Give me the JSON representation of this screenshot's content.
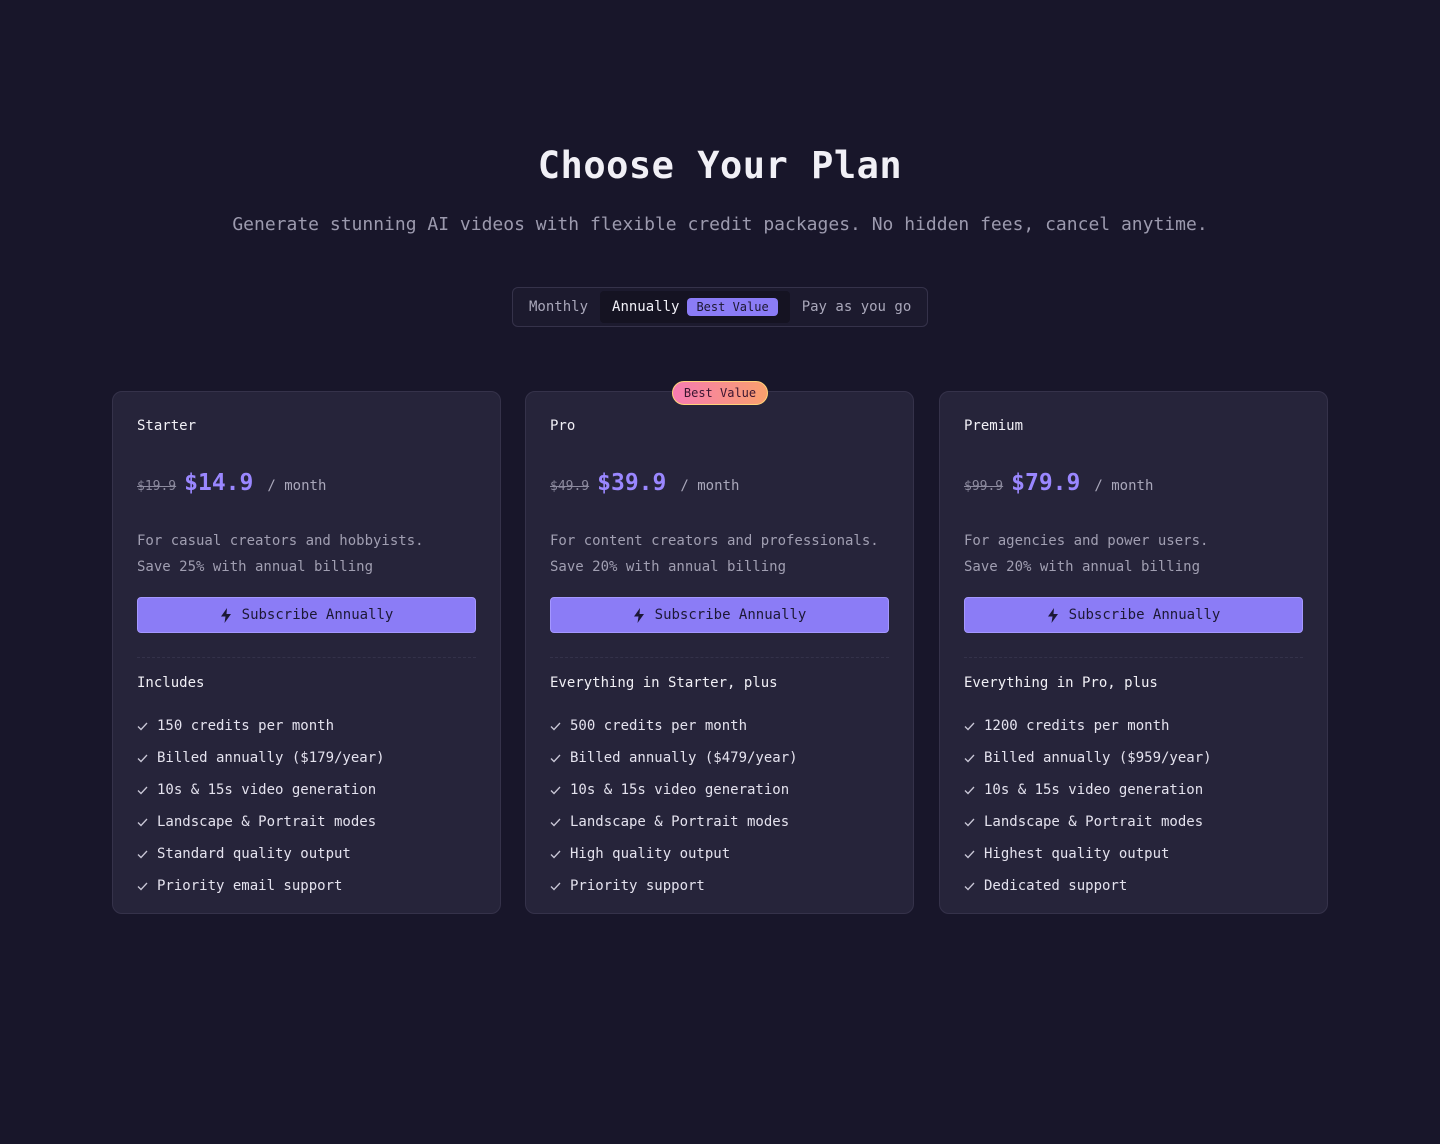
{
  "header": {
    "title": "Choose Your Plan",
    "subtitle": "Generate stunning AI videos with flexible credit packages. No hidden fees, cancel anytime."
  },
  "billing_toggle": {
    "monthly": "Monthly",
    "annually": "Annually",
    "annually_badge": "Best Value",
    "payg": "Pay as you go",
    "selected": "Annually"
  },
  "colors": {
    "accent": "#8b7cf6",
    "background": "#18162a",
    "card": "#26243a"
  },
  "plans": [
    {
      "name": "Starter",
      "old_price": "$19.9",
      "price": "$14.9",
      "period": "/ month",
      "description": "For casual creators and hobbyists.",
      "savings": "Save 25% with annual billing",
      "button": "Subscribe Annually",
      "button_icon": "lightning-icon",
      "includes_title": "Includes",
      "features": [
        "150 credits per month",
        "Billed annually ($179/year)",
        "10s & 15s video generation",
        "Landscape & Portrait modes",
        "Standard quality output",
        "Priority email support"
      ]
    },
    {
      "name": "Pro",
      "badge": "Best Value",
      "old_price": "$49.9",
      "price": "$39.9",
      "period": "/ month",
      "description": "For content creators and professionals.",
      "savings": "Save 20% with annual billing",
      "button": "Subscribe Annually",
      "button_icon": "lightning-icon",
      "includes_title": "Everything in Starter, plus",
      "features": [
        "500 credits per month",
        "Billed annually ($479/year)",
        "10s & 15s video generation",
        "Landscape & Portrait modes",
        "High quality output",
        "Priority support"
      ]
    },
    {
      "name": "Premium",
      "old_price": "$99.9",
      "price": "$79.9",
      "period": "/ month",
      "description": "For agencies and power users.",
      "savings": "Save 20% with annual billing",
      "button": "Subscribe Annually",
      "button_icon": "lightning-icon",
      "includes_title": "Everything in Pro, plus",
      "features": [
        "1200 credits per month",
        "Billed annually ($959/year)",
        "10s & 15s video generation",
        "Landscape & Portrait modes",
        "Highest quality output",
        "Dedicated support"
      ]
    }
  ]
}
